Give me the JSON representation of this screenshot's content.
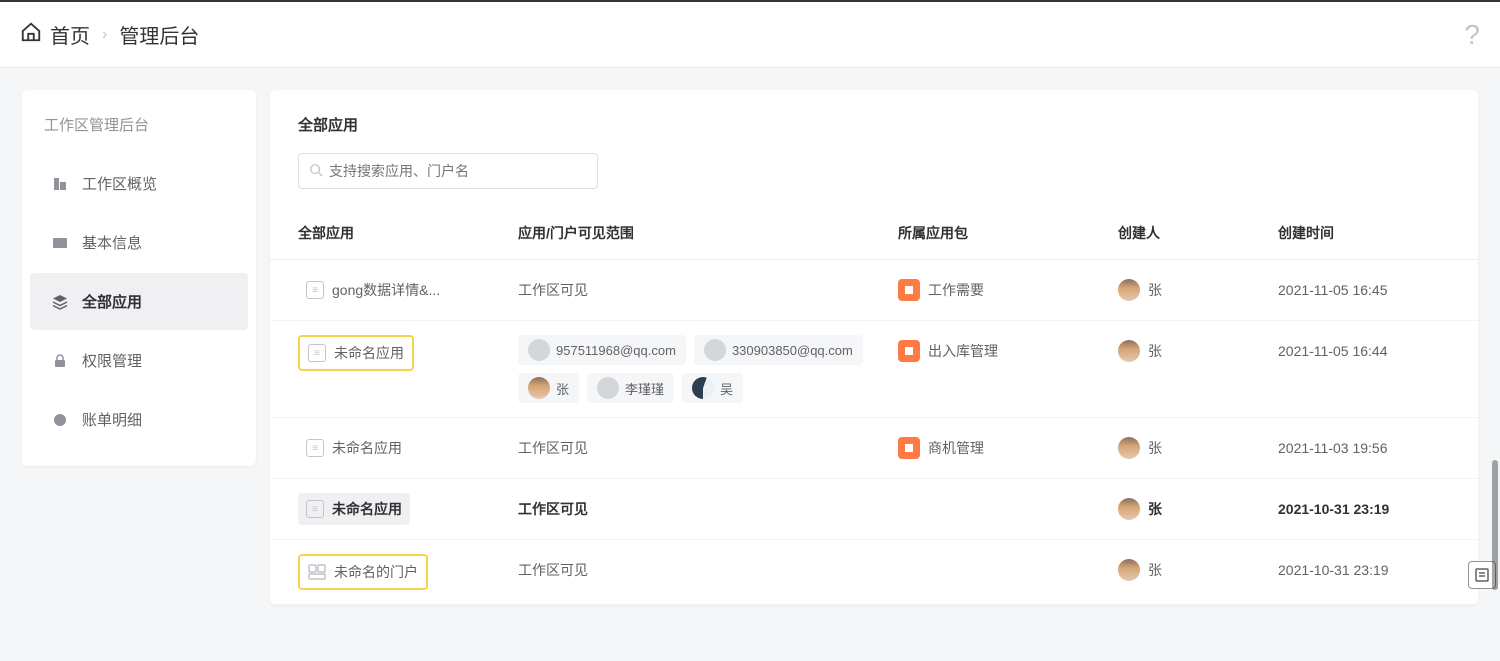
{
  "breadcrumb": {
    "home": "首页",
    "current": "管理后台"
  },
  "sidebar": {
    "title": "工作区管理后台",
    "items": [
      {
        "label": "工作区概览"
      },
      {
        "label": "基本信息"
      },
      {
        "label": "全部应用"
      },
      {
        "label": "权限管理"
      },
      {
        "label": "账单明细"
      }
    ]
  },
  "main": {
    "title": "全部应用",
    "search_placeholder": "支持搜索应用、门户名"
  },
  "table": {
    "headers": {
      "name": "全部应用",
      "visibility": "应用/门户可见范围",
      "package": "所属应用包",
      "creator": "创建人",
      "time": "创建时间"
    },
    "rows": [
      {
        "name": "gong数据详情&...",
        "visibility_text": "工作区可见",
        "package": "工作需要",
        "creator": "张",
        "time": "2021-11-05 16:45"
      },
      {
        "name": "未命名应用",
        "visibility_chips": [
          {
            "label": "957511968@qq.com",
            "avatar": "gray"
          },
          {
            "label": "330903850@qq.com",
            "avatar": "gray"
          },
          {
            "label": "张",
            "avatar": "photo"
          },
          {
            "label": "李瑾瑾",
            "avatar": "gray"
          },
          {
            "label": "吴",
            "avatar": "wu"
          }
        ],
        "package": "出入库管理",
        "creator": "张",
        "time": "2021-11-05 16:44"
      },
      {
        "name": "未命名应用",
        "visibility_text": "工作区可见",
        "package": "商机管理",
        "creator": "张",
        "time": "2021-11-03 19:56"
      },
      {
        "name": "未命名应用",
        "visibility_text": "工作区可见",
        "package": "",
        "creator": "张",
        "time": "2021-10-31 23:19"
      },
      {
        "name": "未命名的门户",
        "visibility_text": "工作区可见",
        "package": "",
        "creator": "张",
        "time": "2021-10-31 23:19"
      }
    ]
  }
}
